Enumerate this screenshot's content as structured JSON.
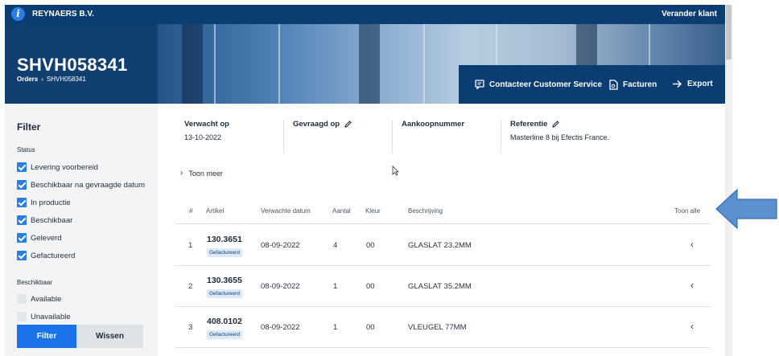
{
  "topbar": {
    "info_icon_glyph": "i",
    "company": "REYNAERS B.V.",
    "change_customer": "Verander klant"
  },
  "hero": {
    "title": "SHVH058341",
    "breadcrumb": {
      "root": "Orders",
      "current": "SHVH058341"
    }
  },
  "actions": [
    {
      "label": "Contacteer Customer Service",
      "icon": "chat-icon"
    },
    {
      "label": "Facturen",
      "icon": "invoice-icon"
    },
    {
      "label": "Export",
      "icon": "export-icon"
    }
  ],
  "sidebar": {
    "title": "Filter",
    "status_label": "Status",
    "status_items": [
      {
        "label": "Levering voorbereid",
        "checked": true
      },
      {
        "label": "Beschikbaar na gevraagde datum",
        "checked": true
      },
      {
        "label": "In productie",
        "checked": true
      },
      {
        "label": "Beschikbaar",
        "checked": true
      },
      {
        "label": "Geleverd",
        "checked": true
      },
      {
        "label": "Gefactureerd",
        "checked": true
      }
    ],
    "availability_label": "Beschikbaar",
    "availability_items": [
      {
        "label": "Available",
        "checked": false
      },
      {
        "label": "Unavailable",
        "checked": false
      }
    ],
    "filter_button": "Filter",
    "clear_button": "Wissen"
  },
  "info": {
    "expected_label": "Verwacht op",
    "expected_value": "13-10-2022",
    "requested_label": "Gevraagd op",
    "purchase_label": "Aankoopnummer",
    "reference_label": "Referentie",
    "reference_value": "Masterline 8 bij Efectis France.",
    "show_more": "Toon meer"
  },
  "table": {
    "headers": {
      "num": "#",
      "article": "Artikel",
      "expected_date": "Verwachte datum",
      "qty": "Aantal",
      "color": "Kleur",
      "description": "Beschrijving",
      "show_all": "Toon alle"
    },
    "rows": [
      {
        "num": "1",
        "article": "130.3651",
        "status": "Gefactureerd",
        "date": "08-09-2022",
        "qty": "4",
        "color": "00",
        "description": "GLASLAT 23.2MM"
      },
      {
        "num": "2",
        "article": "130.3655",
        "status": "Gefactureerd",
        "date": "08-09-2022",
        "qty": "1",
        "color": "00",
        "description": "GLASLAT 35.2MM"
      },
      {
        "num": "3",
        "article": "408.0102",
        "status": "Gefactureerd",
        "date": "08-09-2022",
        "qty": "1",
        "color": "00",
        "description": "VLEUGEL 77MM"
      }
    ]
  },
  "colors": {
    "navy": "#0b3d73",
    "accent": "#1a73e8",
    "arrow": "#5b8fcf"
  }
}
